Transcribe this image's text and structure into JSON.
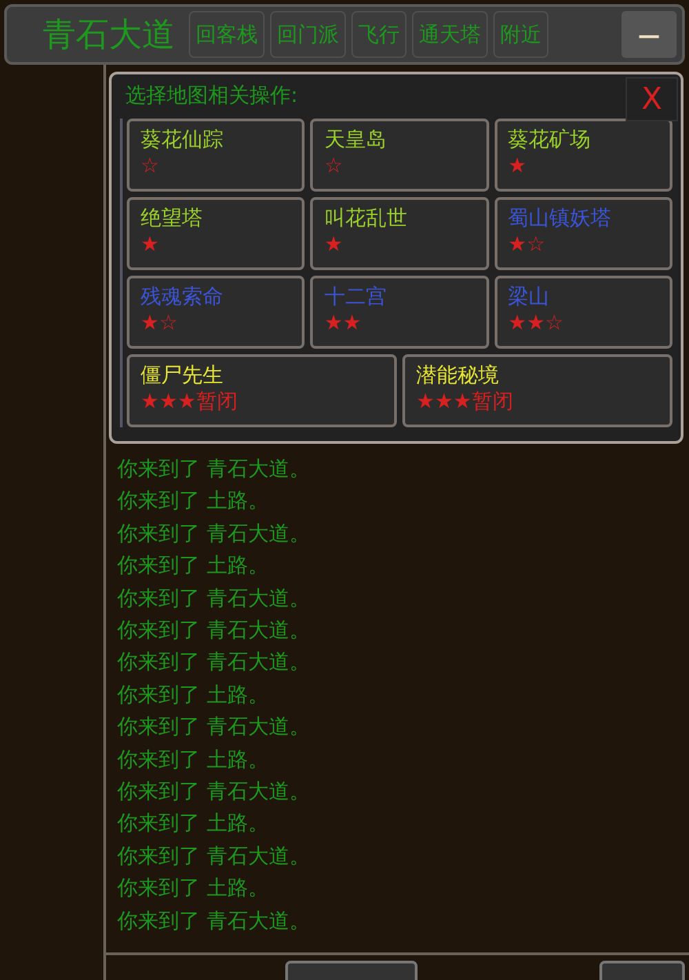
{
  "top_bar": {
    "title": "青石大道",
    "buttons": [
      "回客栈",
      "回门派",
      "飞行",
      "通天塔",
      "附近"
    ],
    "minimize": "—"
  },
  "popup": {
    "title": "选择地图相关操作:",
    "close": "X",
    "places": [
      {
        "name": "葵花仙踪",
        "color": "#9ad22a",
        "rating": "☆",
        "wide": false
      },
      {
        "name": "天皇岛",
        "color": "#9ad22a",
        "rating": "☆",
        "wide": false
      },
      {
        "name": "葵花矿场",
        "color": "#9ad22a",
        "rating": "★",
        "wide": false
      },
      {
        "name": "绝望塔",
        "color": "#9ad22a",
        "rating": "★",
        "wide": false
      },
      {
        "name": "叫花乱世",
        "color": "#9ad22a",
        "rating": "★",
        "wide": false
      },
      {
        "name": "蜀山镇妖塔",
        "color": "#3a55d8",
        "rating": "★☆",
        "wide": false
      },
      {
        "name": "残魂索命",
        "color": "#3a55d8",
        "rating": "★☆",
        "wide": false
      },
      {
        "name": "十二宫",
        "color": "#3a55d8",
        "rating": "★★",
        "wide": false
      },
      {
        "name": "梁山",
        "color": "#3a55d8",
        "rating": "★★☆",
        "wide": false
      },
      {
        "name": "僵尸先生",
        "color": "#e8e830",
        "rating": "★★★",
        "note": "暂闭",
        "wide": true
      },
      {
        "name": "潜能秘境",
        "color": "#e8e830",
        "rating": "★★★",
        "note": "暂闭",
        "wide": true
      }
    ]
  },
  "log": [
    "你来到了 青石大道。",
    "你来到了 土路。",
    "你来到了 青石大道。",
    "你来到了 土路。",
    "你来到了 青石大道。",
    "你来到了 青石大道。",
    "你来到了 青石大道。",
    "你来到了 土路。",
    "你来到了 青石大道。",
    "你来到了 土路。",
    "你来到了 青石大道。",
    "你来到了 土路。",
    "你来到了 青石大道。",
    "你来到了 土路。",
    "你来到了 青石大道。"
  ]
}
